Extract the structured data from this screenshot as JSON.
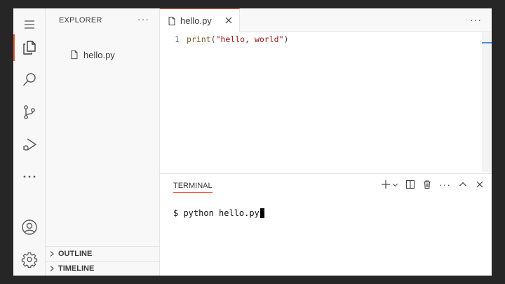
{
  "activity_bar": {
    "items": [
      {
        "icon": "menu-icon"
      },
      {
        "icon": "files-icon",
        "active": true
      },
      {
        "icon": "search-icon"
      },
      {
        "icon": "source-control-icon"
      },
      {
        "icon": "run-debug-icon"
      },
      {
        "icon": "more-icon"
      },
      {
        "icon": "account-icon"
      },
      {
        "icon": "gear-icon"
      }
    ]
  },
  "sidebar": {
    "title": "EXPLORER",
    "more": "···",
    "files": [
      {
        "name": "hello.py",
        "icon": "file-icon"
      }
    ],
    "sections": [
      {
        "label": "OUTLINE"
      },
      {
        "label": "TIMELINE"
      }
    ]
  },
  "editor": {
    "tab": {
      "label": "hello.py"
    },
    "more": "···",
    "lines": [
      {
        "number": "1",
        "fn": "print",
        "open": "(",
        "str": "\"hello, world\"",
        "close": ")"
      }
    ]
  },
  "panel": {
    "tab": "TERMINAL",
    "more": "···",
    "terminal_text": "$ python hello.py"
  },
  "colors": {
    "accent": "#f05a3c",
    "background": "#ffffff",
    "sidebar": "#f8f8f8"
  }
}
